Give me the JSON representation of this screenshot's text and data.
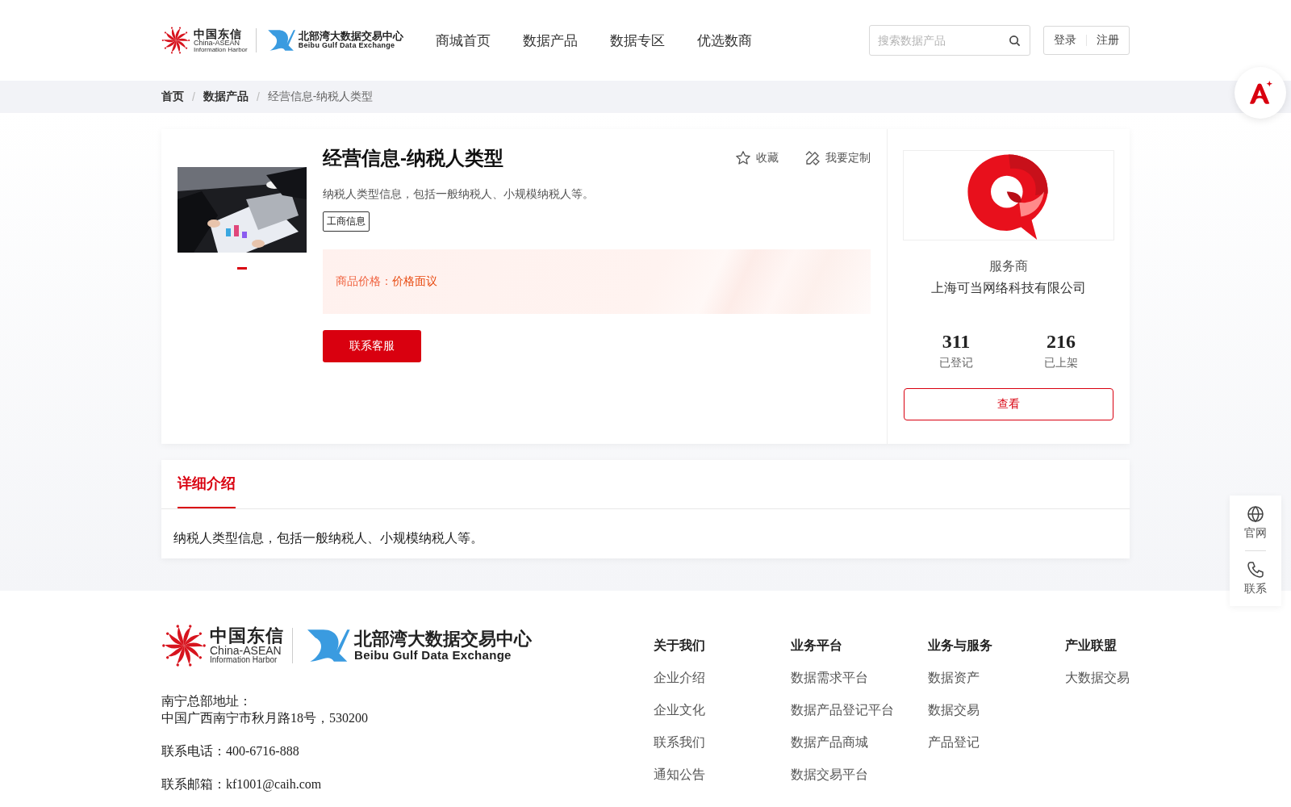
{
  "header": {
    "logo": {
      "brand_cn": "中国东信",
      "brand_en": "China-ASEAN",
      "brand_sub": "Information Harbor",
      "exchange_cn": "北部湾大数据交易中心",
      "exchange_en": "Beibu Gulf Data Exchange"
    },
    "nav": [
      "商城首页",
      "数据产品",
      "数据专区",
      "优选数商"
    ],
    "search": {
      "placeholder": "搜索数据产品"
    },
    "auth": [
      "登录",
      "注册"
    ]
  },
  "breadcrumb": [
    "首页",
    "数据产品",
    "经营信息-纳税人类型"
  ],
  "breadcrumb_separator": "/",
  "product": {
    "carousel": [
      {
        "selected": true
      }
    ],
    "title": "经营信息-纳税人类型",
    "actions": [
      {
        "label": "收藏",
        "kind": "star"
      },
      {
        "label": "我要定制",
        "kind": "custom"
      }
    ],
    "description": "纳税人类型信息，包括一般纳税人、小规模纳税人等。",
    "tag": "工商信息",
    "price_label": "商品价格：",
    "price_value": "价格面议",
    "contact_button": "联系客服"
  },
  "vendor": {
    "role": "服务商",
    "name": "上海可当网络科技有限公司",
    "stats": [
      {
        "value": "311",
        "label": "已登记"
      },
      {
        "value": "216",
        "label": "已上架"
      }
    ],
    "view_button": "查看"
  },
  "detail": {
    "tabs": [
      {
        "label": "详细介绍",
        "selected": true
      }
    ],
    "text": "纳税人类型信息，包括一般纳税人、小规模纳税人等。"
  },
  "footer": {
    "logo": {
      "brand_cn": "中国东信",
      "brand_en": "China-ASEAN",
      "brand_sub": "Information Harbor",
      "exchange_cn": "北部湾大数据交易中心",
      "exchange_en": "Beibu Gulf Data Exchange"
    },
    "address_label": "南宁总部地址：",
    "address": "中国广西南宁市秋月路18号，530200",
    "phone": "联系电话：400-6716-888",
    "email": "联系邮箱：kf1001@caih.com",
    "columns": [
      {
        "title": "关于我们",
        "links": [
          "企业介绍",
          "企业文化",
          "联系我们",
          "通知公告"
        ]
      },
      {
        "title": "业务平台",
        "links": [
          "数据需求平台",
          "数据产品登记平台",
          "数据产品商城",
          "数据交易平台"
        ]
      },
      {
        "title": "业务与服务",
        "links": [
          "数据资产",
          "数据交易",
          "产品登记"
        ]
      },
      {
        "title": "产业联盟",
        "links": [
          "大数据交易"
        ]
      }
    ]
  },
  "side_panel": [
    {
      "label": "官网",
      "kind": "globe"
    },
    {
      "label": "联系",
      "kind": "phone"
    }
  ]
}
